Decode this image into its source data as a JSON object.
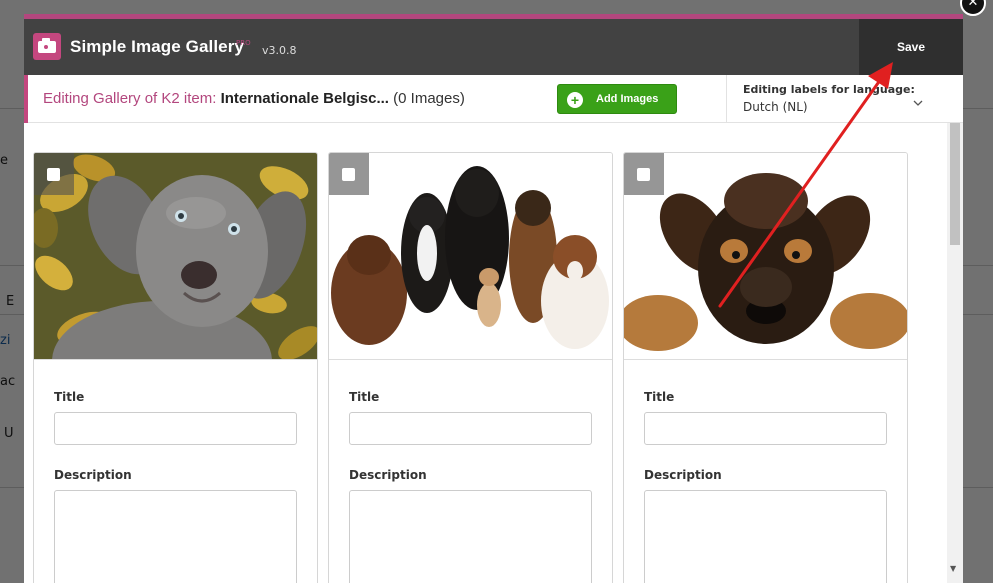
{
  "app": {
    "title": "Simple Image Gallery",
    "pro_tag": "PRO",
    "version": "v3.0.8",
    "save_label": "Save"
  },
  "toolbar": {
    "editing_prefix": "Editing Gallery of K2 item:",
    "item_name": "Internationale Belgisc...",
    "image_count": "(0 Images)",
    "add_images_label": "Add Images",
    "language_label": "Editing labels for language:",
    "language_value": "Dutch (NL)"
  },
  "gallery": {
    "cards": [
      {
        "image_icon": "weimaraner-puppy-photo",
        "title_label": "Title",
        "description_label": "Description"
      },
      {
        "image_icon": "group-of-dogs-photo",
        "title_label": "Title",
        "description_label": "Description"
      },
      {
        "image_icon": "german-shepherd-puppy-photo",
        "title_label": "Title",
        "description_label": "Description"
      }
    ]
  },
  "background": {
    "fragments": [
      "e",
      "E",
      "zi",
      "ac",
      "U"
    ]
  },
  "colors": {
    "brand": "#c4477f",
    "header": "#424242",
    "save_bg": "#2f2f2f",
    "add_button": "#3aa118",
    "annotation_arrow": "#e02020"
  },
  "icons": {
    "logo": "camera-icon",
    "add": "plus-circle-icon",
    "language_dropdown": "chevron-down-icon",
    "close": "close-icon",
    "checkbox": "checkbox-icon"
  }
}
